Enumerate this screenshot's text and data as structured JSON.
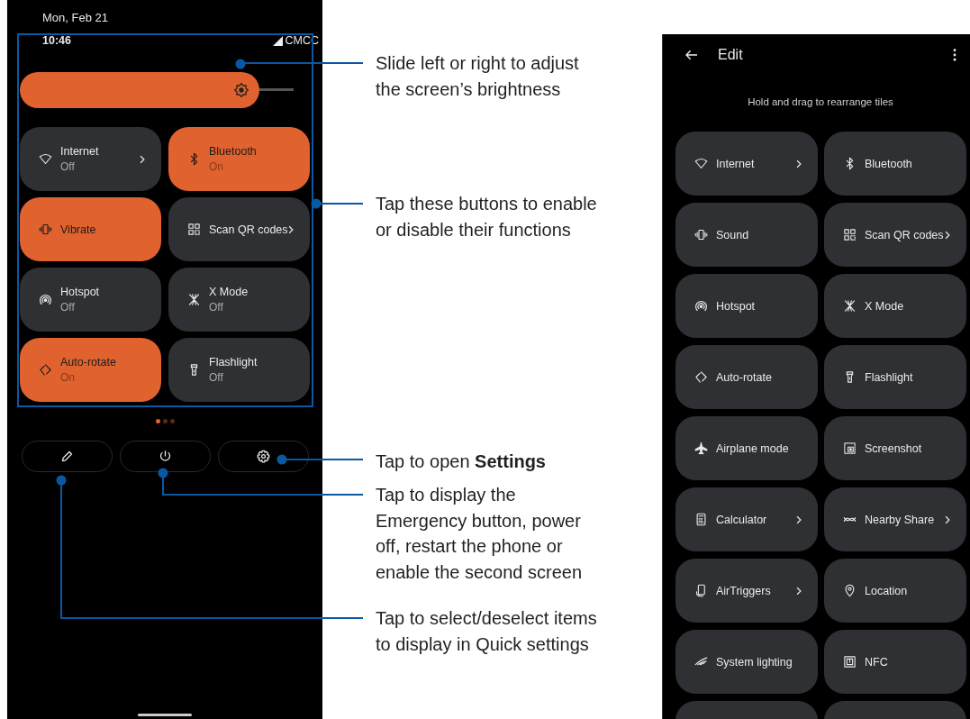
{
  "quick_settings": {
    "date": "Mon, Feb 21",
    "time": "10:46",
    "carrier": "CMCC",
    "brightness": {
      "level": 0.875
    },
    "tiles": [
      {
        "label": "Internet",
        "status": "Off",
        "on": false,
        "chevron": true
      },
      {
        "label": "Bluetooth",
        "status": "On",
        "on": true,
        "chevron": false
      },
      {
        "label": "Vibrate",
        "on": true,
        "chevron": false
      },
      {
        "label": "Scan QR codes",
        "on": false,
        "chevron": true
      },
      {
        "label": "Hotspot",
        "status": "Off",
        "on": false,
        "chevron": false
      },
      {
        "label": "X Mode",
        "status": "Off",
        "on": false,
        "chevron": false
      },
      {
        "label": "Auto-rotate",
        "status": "On",
        "on": true,
        "chevron": false
      },
      {
        "label": "Flashlight",
        "status": "Off",
        "on": false,
        "chevron": false
      }
    ],
    "pages": [
      {
        "selected": true
      },
      {
        "selected": false
      },
      {
        "selected": false
      }
    ]
  },
  "callouts": [
    {
      "text": "Slide left or right to adjust the screen’s brightness"
    },
    {
      "text": "Tap these buttons to enable or disable their functions"
    },
    {
      "text": "Tap to open **Settings**"
    },
    {
      "text": "Tap to display the Emergency button, power off, restart the phone or enable the second screen"
    },
    {
      "text": "Tap to select/deselect items to display in Quick settings"
    }
  ],
  "edit_screen": {
    "title": "Edit",
    "hint": "Hold and drag to rearrange tiles",
    "tiles": [
      {
        "label": "Internet",
        "chevron": true
      },
      {
        "label": "Bluetooth",
        "chevron": false
      },
      {
        "label": "Sound",
        "chevron": false
      },
      {
        "label": "Scan QR codes",
        "chevron": true
      },
      {
        "label": "Hotspot",
        "chevron": false
      },
      {
        "label": "X Mode",
        "chevron": false
      },
      {
        "label": "Auto-rotate",
        "chevron": false
      },
      {
        "label": "Flashlight",
        "chevron": false
      },
      {
        "label": "Airplane mode",
        "chevron": false
      },
      {
        "label": "Screenshot",
        "chevron": false
      },
      {
        "label": "Calculator",
        "chevron": true
      },
      {
        "label": "Nearby Share",
        "chevron": true
      },
      {
        "label": "AirTriggers",
        "chevron": true
      },
      {
        "label": "Location",
        "chevron": false
      },
      {
        "label": "System lighting",
        "chevron": false
      },
      {
        "label": "NFC",
        "chevron": false
      }
    ]
  }
}
